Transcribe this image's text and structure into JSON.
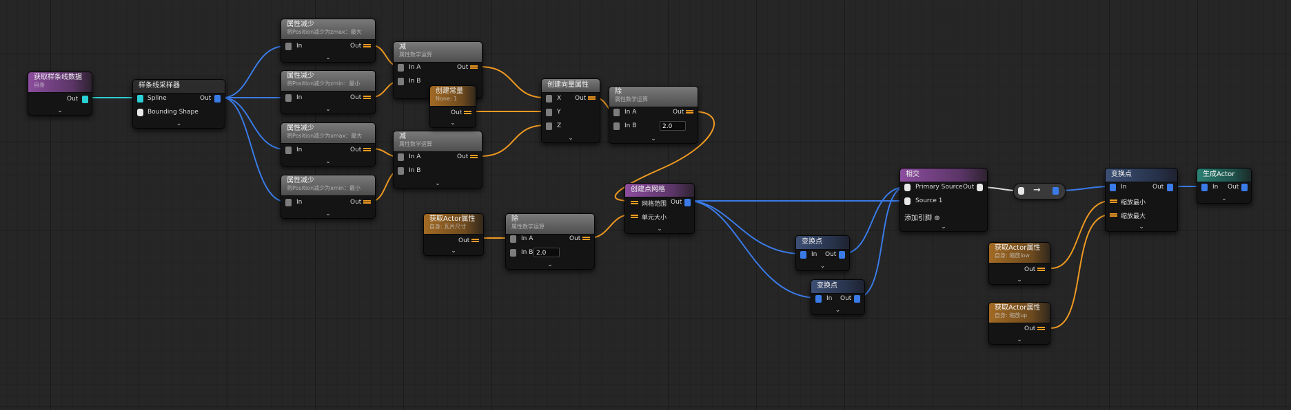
{
  "colors": {
    "background": "#262626",
    "blue_wire": "#3a7be8",
    "orange_wire": "#f09a21",
    "cyan_wire": "#2ad0d6"
  },
  "nodes": {
    "get_spline": {
      "title": "获取样条线数据",
      "sub": "自身",
      "out": "Out"
    },
    "spline_sampler": {
      "title": "样条线采样器",
      "in1": "Spline",
      "in2": "Bounding Shape",
      "out": "Out"
    },
    "prop_a": {
      "title": "属性减少",
      "sub": "将Position减少为zmax：最大",
      "in": "In",
      "out": "Out"
    },
    "prop_b": {
      "title": "属性减少",
      "sub": "将Position减少为zmin：最小",
      "in": "In",
      "out": "Out"
    },
    "prop_c": {
      "title": "属性减少",
      "sub": "将Position减少为xmax：最大",
      "in": "In",
      "out": "Out"
    },
    "prop_d": {
      "title": "属性减少",
      "sub": "将Position减少为xmin：最小",
      "in": "In",
      "out": "Out"
    },
    "sub_1": {
      "title": "减",
      "sub": "属性数学运算",
      "inA": "In A",
      "inB": "In B",
      "out": "Out"
    },
    "sub_2": {
      "title": "减",
      "sub": "属性数学运算",
      "inA": "In A",
      "inB": "In B",
      "out": "Out"
    },
    "const": {
      "title": "创建常量",
      "sub": "None: 1",
      "out": "Out"
    },
    "make_vec": {
      "title": "创建向量属性",
      "x": "X",
      "y": "Y",
      "z": "Z",
      "out": "Out"
    },
    "div_1": {
      "title": "除",
      "sub": "属性数学运算",
      "inA": "In A",
      "inB": "In B",
      "inB_val": "2.0",
      "out": "Out"
    },
    "grid": {
      "title": "创建点网格",
      "in1": "网格范围",
      "in2": "单元大小",
      "out": "Out"
    },
    "get_actor_1": {
      "title": "获取Actor属性",
      "sub": "自身: 瓦片尺寸",
      "out": "Out"
    },
    "div_2": {
      "title": "除",
      "sub": "属性数学运算",
      "inA": "In A",
      "inB": "In B",
      "inB_val": "2.0",
      "out": "Out"
    },
    "transform_1": {
      "title": "变换点",
      "in": "In",
      "out": "Out"
    },
    "transform_2": {
      "title": "变换点",
      "in": "In",
      "out": "Out"
    },
    "intersect": {
      "title": "相交",
      "in1": "Primary Source",
      "in2": "Source 1",
      "add_pin": "添加引脚",
      "out": "Out"
    },
    "get_actor_low": {
      "title": "获取Actor属性",
      "sub": "自身: 缩放low",
      "out": "Out"
    },
    "get_actor_up": {
      "title": "获取Actor属性",
      "sub": "自身: 缩放up",
      "out": "Out"
    },
    "transform_3": {
      "title": "变换点",
      "in1": "In",
      "in2": "缩放最小",
      "in3": "缩放最大",
      "out": "Out"
    },
    "spawn": {
      "title": "生成Actor",
      "in": "In",
      "out": "Out"
    }
  }
}
